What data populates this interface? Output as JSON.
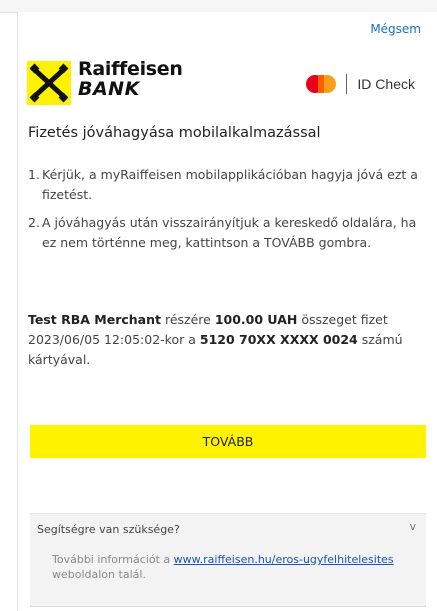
{
  "header": {
    "cancel_label": "Mégsem"
  },
  "brand": {
    "logo_icon": "raiffeisen-cross-logo",
    "name_line1": "Raiffeisen",
    "name_line2": "BANK",
    "id_check_label": "ID Check",
    "colors": {
      "logo_yellow": "#fff200",
      "mastercard_red": "#eb001b",
      "mastercard_orange": "#f79e1b"
    }
  },
  "title": "Fizetés jóváhagyása mobilalkalmazással",
  "steps": [
    {
      "num": "1.",
      "text": "Kérjük, a myRaiffeisen mobilapplikációban hagyja jóvá ezt a fizetést."
    },
    {
      "num": "2.",
      "text": "A jóváhagyás után visszairányítjuk a kereskedő oldalára, ha ez nem történne meg, kattintson a TOVÁBB gombra."
    }
  ],
  "payment": {
    "merchant": "Test RBA Merchant",
    "text1": "részére",
    "amount": "100.00 UAH",
    "text2": "összeget fizet",
    "datetime": "2023/06/05 12:05:02",
    "text3": "-kor a",
    "card": "5120 70XX XXXX 0024",
    "text4": "számú kártyával."
  },
  "continue_button": "TOVÁBB",
  "help": {
    "title": "Segítségre van szüksége?",
    "chevron": "v",
    "text_before": "További információt a",
    "link": "www.raiffeisen.hu/eros-ugyfelhitelesites",
    "text_after": "weboldalon talál."
  }
}
